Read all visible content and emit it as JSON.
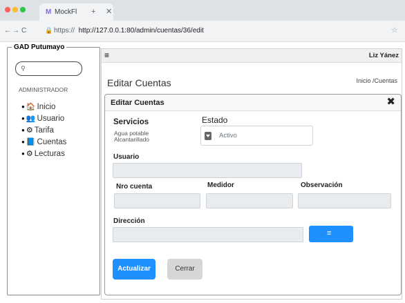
{
  "colors": {
    "window_red": "#ff5f57",
    "window_yellow": "#febc2e",
    "window_green": "#28c840",
    "primary": "#1e90ff",
    "secondary": "#d6d6d6"
  },
  "browser": {
    "tab": {
      "logo": "M",
      "title": "MockFl",
      "new_tab": "+",
      "close": "✕"
    },
    "nav": {
      "back": "←",
      "forward": "→",
      "reload": "C"
    },
    "lock": "🔒",
    "url_scheme": "https://",
    "url": "http://127.0.0.1:80/admin/cuentas/36/edit",
    "star": "☆"
  },
  "sidebar": {
    "title": "GAD Putumayo",
    "search_placeholder": "",
    "search_icon": "⚲",
    "role": "ADMINISTRADOR",
    "items": [
      {
        "label": "Inicio",
        "icon": "home-icon",
        "glyph": "🏠"
      },
      {
        "label": "Usuario",
        "icon": "users-icon",
        "glyph": "👥"
      },
      {
        "label": "Tarifa",
        "icon": "gauge-icon",
        "glyph": "⚙"
      },
      {
        "label": "Cuentas",
        "icon": "book-icon",
        "glyph": "📘"
      },
      {
        "label": "Lecturas",
        "icon": "gauge-icon",
        "glyph": "⚙"
      }
    ]
  },
  "header": {
    "menu_icon": "≡",
    "user_name": "Liz Yánez"
  },
  "page": {
    "title": "Editar Cuentas",
    "breadcrumb": "Inicio /Cuentas"
  },
  "form": {
    "title": "Editar Cuentas",
    "close_icon": "✖",
    "servicios_label": "Servicios",
    "servicios_items": [
      "Agua potable",
      "Alcantarillado"
    ],
    "estado_label": "Estado",
    "estado_value": "Activo",
    "usuario_label": "Usuario",
    "usuario_value": "",
    "nro_cuenta_label": "Nro cuenta",
    "nro_cuenta_value": "",
    "medidor_label": "Medidor",
    "medidor_value": "",
    "observacion_label": "Observación",
    "observacion_value": "",
    "direccion_label": "Dirección",
    "direccion_value": "",
    "list_icon": "≡",
    "submit_label": "Actualizar",
    "close_label": "Cerrar"
  }
}
